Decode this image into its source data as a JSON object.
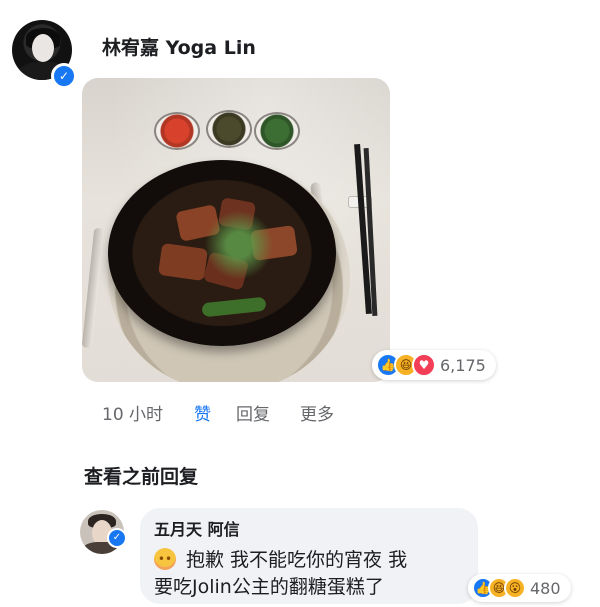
{
  "post": {
    "author": "林宥嘉 Yoga Lin",
    "avatar_icon": "profile-photo",
    "verified_icon": "verified-check-icon",
    "photo_subject": "braised meat stew in black bowl",
    "reactions": {
      "icons": [
        "like-icon",
        "haha-icon",
        "love-icon"
      ],
      "count": "6,175"
    },
    "actions": {
      "time": "10 小时",
      "like": "赞",
      "reply": "回复",
      "more": "更多"
    }
  },
  "view_previous_replies": "查看之前回复",
  "reply": {
    "author": "五月天 阿信",
    "emoji_icon": "flushed-face-icon",
    "line1": "抱歉 我不能吃你的宵夜 我",
    "line2": "要吃Jolin公主的翻糖蛋糕了",
    "reactions": {
      "icons": [
        "like-icon",
        "haha-icon",
        "wow-icon"
      ],
      "count": "480"
    }
  },
  "colors": {
    "accent": "#1877f2",
    "bubble": "#f0f2f5",
    "secondary_text": "#65676b"
  }
}
